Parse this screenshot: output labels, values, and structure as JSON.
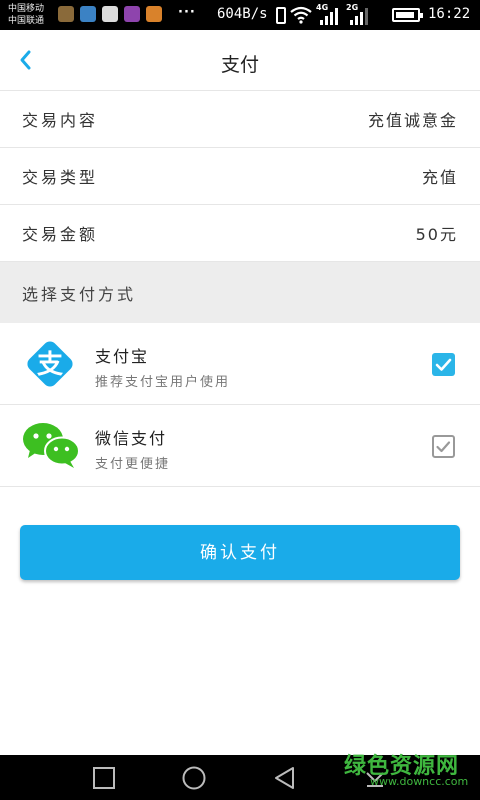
{
  "status_bar": {
    "carrier_1": "中国移动",
    "carrier_2": "中国联通",
    "more": "···",
    "net_speed": "604B/s",
    "network_1": "4G",
    "network_2": "2G",
    "time": "16:22",
    "battery_level": 0.9,
    "notification_colors": [
      "#8a6a3a",
      "#3b82c4",
      "#dcdcdc",
      "#8e44ad",
      "#d9822b"
    ]
  },
  "header": {
    "title": "支付",
    "back_icon": "chevron-left-icon",
    "accent_color": "#1aabe9"
  },
  "transaction": {
    "rows": [
      {
        "label": "交易内容",
        "value": "充值诚意金"
      },
      {
        "label": "交易类型",
        "value": "充值"
      },
      {
        "label": "交易金额",
        "value": "50元"
      }
    ]
  },
  "payment": {
    "section_title": "选择支付方式",
    "options": [
      {
        "name": "支付宝",
        "desc": "推荐支付宝用户使用",
        "icon": "alipay-icon",
        "logo_char": "支",
        "checked": true
      },
      {
        "name": "微信支付",
        "desc": "支付更便捷",
        "icon": "wechat-icon",
        "checked": false
      }
    ]
  },
  "confirm": {
    "label": "确认支付"
  },
  "watermark": {
    "title": "绿色资源网",
    "url": "www.downcc.com"
  }
}
